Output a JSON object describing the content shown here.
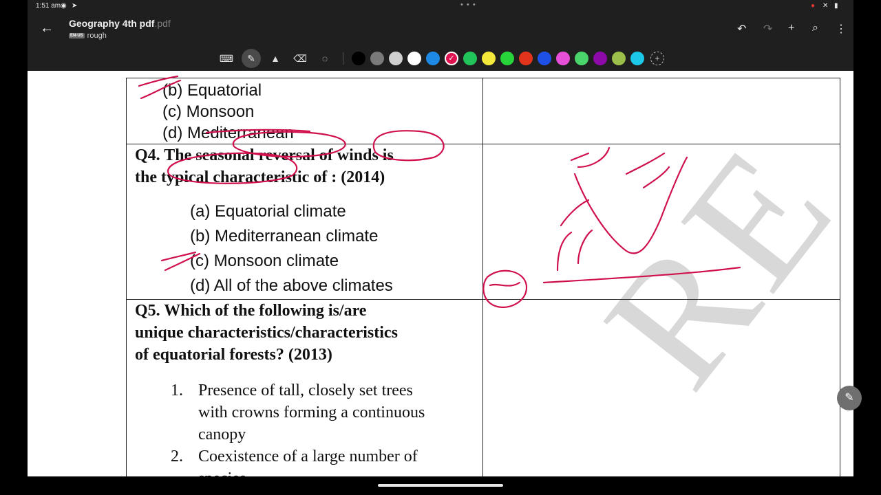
{
  "status": {
    "time": "1:51 am"
  },
  "appbar": {
    "title": "Geography 4th pdf",
    "title_ext": ".pdf",
    "lang_tag": "EN-US",
    "subtitle": "rough"
  },
  "toolbar": {
    "colors": [
      "#000000",
      "#7a7a7a",
      "#cfcfcf",
      "#ffffff",
      "#1e88e5",
      "#e0124f",
      "#21c45a",
      "#f4e93a",
      "#27d53b",
      "#e2341d",
      "#1e4fe6",
      "#e64fd7",
      "#4bd46b",
      "#8e0aa8",
      "#9bbf4a",
      "#1cc7e8"
    ],
    "selected_color": "#e0124f"
  },
  "document": {
    "prev_options": [
      "(b) Equatorial",
      "(c) Monsoon",
      "(d) Mediterranean"
    ],
    "q4": {
      "line1": "Q4. The seasonal reversal of winds is",
      "line2": "the typical characteristic of : (2014)",
      "options": [
        "(a) Equatorial climate",
        "(b) Mediterranean climate",
        "(c) Monsoon climate",
        "(d) All of the above climates"
      ]
    },
    "q5": {
      "line1": "Q5. Which of the following is/are",
      "line2": "unique characteristics/characteristics",
      "line3": "of equatorial forests? (2013)",
      "items": [
        {
          "num": "1.",
          "lines": [
            "Presence of tall, closely set trees",
            "with crowns forming a continuous",
            "canopy"
          ]
        },
        {
          "num": "2.",
          "lines": [
            "Coexistence  of a large number of",
            "species"
          ]
        }
      ]
    },
    "watermark": "RE"
  }
}
